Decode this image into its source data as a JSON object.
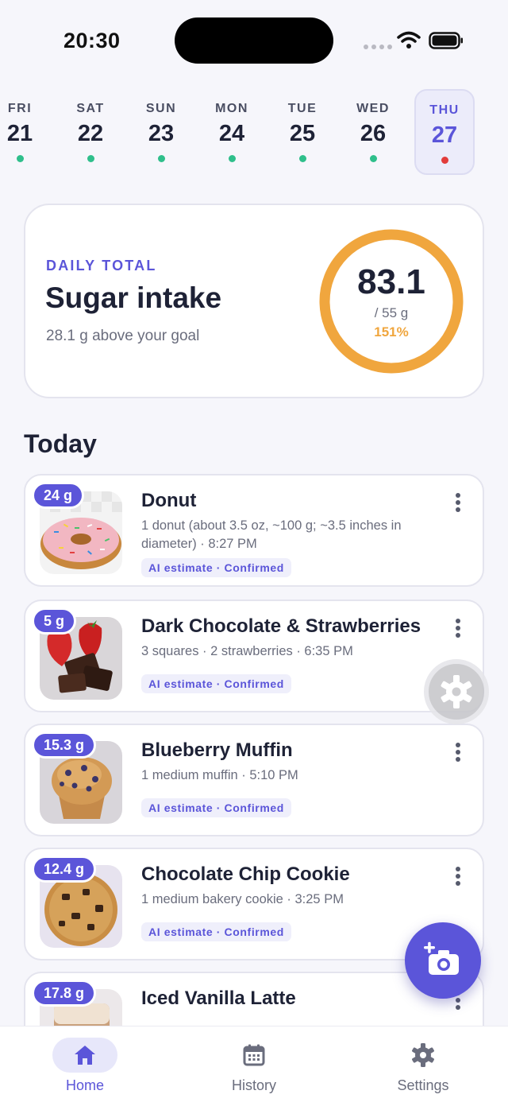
{
  "status_bar": {
    "time": "20:30"
  },
  "week": [
    {
      "dow": "FRI",
      "date": "21",
      "status": "under"
    },
    {
      "dow": "SAT",
      "date": "22",
      "status": "under"
    },
    {
      "dow": "SUN",
      "date": "23",
      "status": "under"
    },
    {
      "dow": "MON",
      "date": "24",
      "status": "under"
    },
    {
      "dow": "TUE",
      "date": "25",
      "status": "under"
    },
    {
      "dow": "WED",
      "date": "26",
      "status": "under"
    },
    {
      "dow": "THU",
      "date": "27",
      "status": "over",
      "selected": true
    }
  ],
  "summary": {
    "eyebrow": "DAILY TOTAL",
    "title": "Sugar intake",
    "subtitle": "28.1 g above your goal",
    "value": "83.1",
    "goal": "/ 55 g",
    "percent": "151%",
    "progress_fraction": 1.0
  },
  "section_title": "Today",
  "entries": [
    {
      "badge": "24 g",
      "name": "Donut",
      "detail": "1 donut (about 3.5 oz, ~100 g; ~3.5 inches in diameter) · 8:27 PM",
      "tag": "AI estimate · Confirmed",
      "image": "donut"
    },
    {
      "badge": "5 g",
      "name": "Dark Chocolate & Strawberries",
      "detail": "3 squares · 2 strawberries · 6:35 PM",
      "tag": "AI estimate · Confirmed",
      "image": "chocolate-strawberries"
    },
    {
      "badge": "15.3 g",
      "name": "Blueberry Muffin",
      "detail": "1 medium muffin · 5:10 PM",
      "tag": "AI estimate · Confirmed",
      "image": "muffin"
    },
    {
      "badge": "12.4 g",
      "name": "Chocolate Chip Cookie",
      "detail": "1 medium bakery cookie · 3:25 PM",
      "tag": "AI estimate · Confirmed",
      "image": "cookie"
    },
    {
      "badge": "17.8 g",
      "name": "Iced Vanilla Latte",
      "detail": "",
      "tag": "",
      "image": "latte"
    }
  ],
  "tabs": [
    {
      "label": "Home",
      "icon": "home-icon",
      "active": true
    },
    {
      "label": "History",
      "icon": "calendar-icon"
    },
    {
      "label": "Settings",
      "icon": "gear-icon"
    }
  ],
  "colors": {
    "accent": "#5b55d9",
    "ring": "#f0a63e",
    "dot_ok": "#2fbf8b",
    "dot_over": "#e23b3b"
  }
}
